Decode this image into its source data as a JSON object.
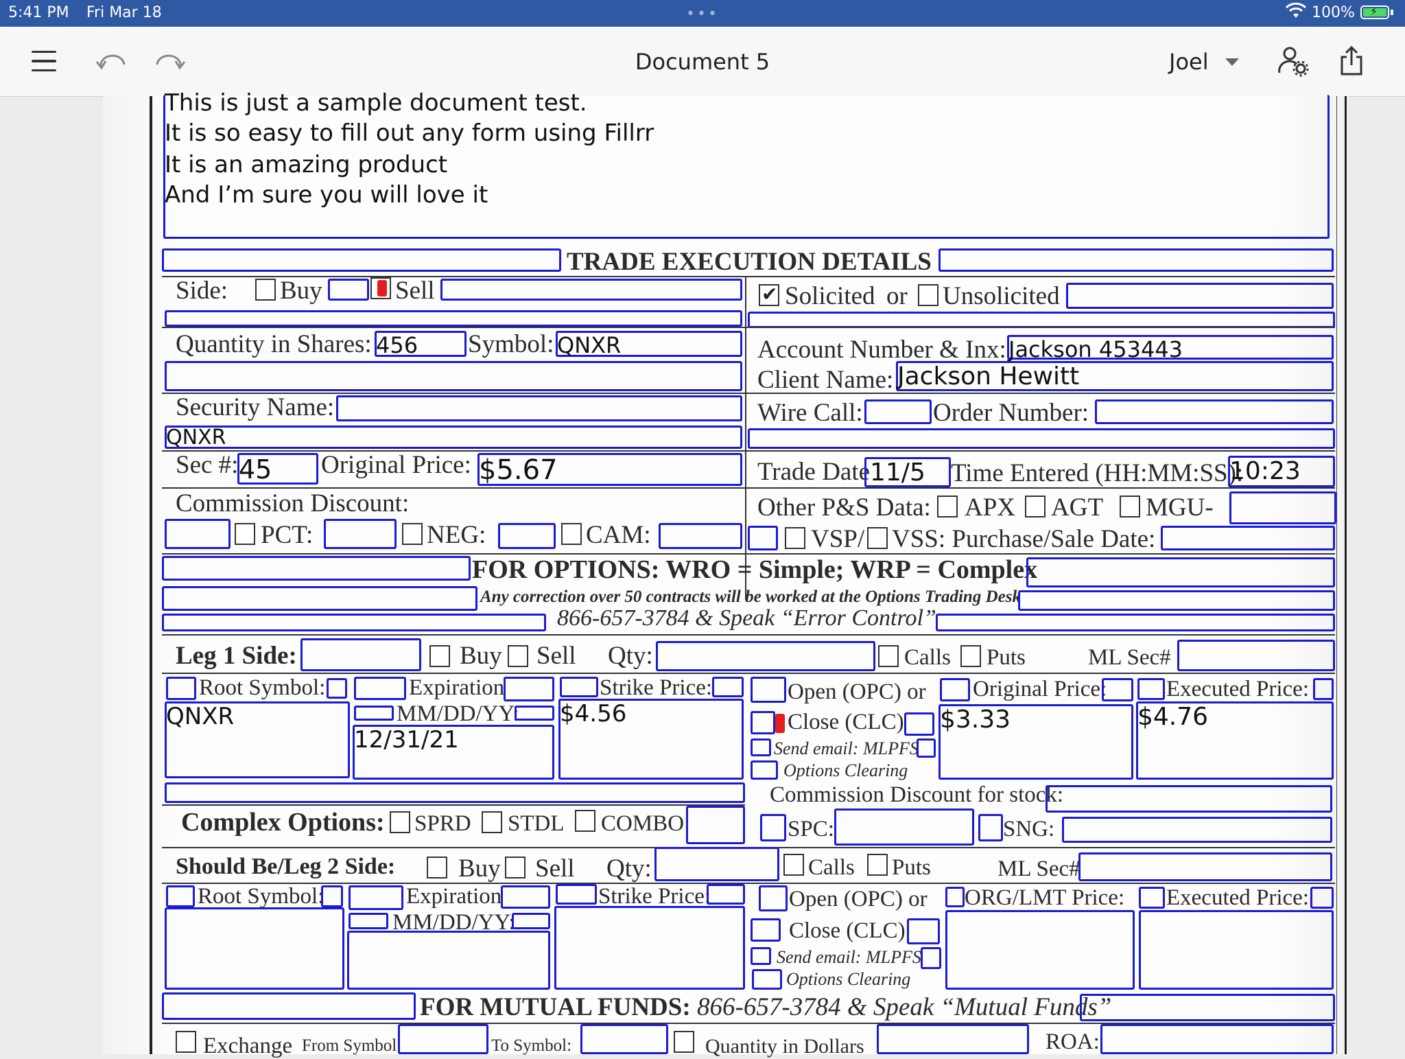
{
  "status_bar": {
    "time": "5:41 PM",
    "date": "Fri Mar 18",
    "battery": "100%"
  },
  "toolbar": {
    "title": "Document 5",
    "user": "Joel"
  },
  "notes": [
    "This is just a sample document test.",
    "It is so easy to fill out any form using Fillrr",
    "It is an amazing product",
    "And I’m sure you will love it"
  ],
  "trade": {
    "heading": "TRADE EXECUTION DETAILS",
    "side_label": "Side:",
    "buy": "Buy",
    "sell": "Sell",
    "solicited": "Solicited",
    "or": "or",
    "unsolicited": "Unsolicited",
    "quantity_label": "Quantity in Shares:",
    "quantity_value": "456",
    "symbol_label": "Symbol:",
    "symbol_value": "QNXR",
    "account_label": "Account Number & Inx:",
    "account_value": "Jackson 453443",
    "client_label": "Client Name:",
    "client_value": "Jackson Hewitt",
    "security_label": "Security Name:",
    "security_value": "QNXR",
    "wire_label": "Wire Call:",
    "order_label": "Order Number:",
    "sec_label": "Sec #:",
    "sec_value": "45",
    "orig_price_label": "Original Price:",
    "orig_price_value": "$5.67",
    "trade_date_label": "Trade Date",
    "trade_date_value": "11/5",
    "time_entered_label": "Time Entered (HH:MM:SS):",
    "time_entered_value": "10:23",
    "commission_label": "Commission Discount:",
    "other_ps_label": "Other P&S Data:",
    "apx": "APX",
    "agt": "AGT",
    "mgu": "MGU-",
    "pct": "PCT:",
    "neg": "NEG:",
    "cam": "CAM:",
    "vsp": "VSP/",
    "vss": "VSS: Purchase/Sale Date:"
  },
  "options": {
    "heading": "FOR OPTIONS: WRO = Simple; WRP = Complex",
    "correction": "Any correction over 50 contracts will be worked at the Options Trading Desk",
    "phone": "866-657-3784 & Speak “Error Control”",
    "leg1_label": "Leg 1  Side:",
    "buy": "Buy",
    "sell": "Sell",
    "qty": "Qty:",
    "calls": "Calls",
    "puts": "Puts",
    "ml_sec": "ML Sec#",
    "root_symbol": "Root Symbol:",
    "root_symbol_value": "QNXR",
    "expiration": "Expiration",
    "mmddyy": "MM/DD/YY:",
    "expiration_value": "12/31/21",
    "strike_price": "Strike Price:",
    "strike_value": "$4.56",
    "open_opc": "Open (OPC) or",
    "close_clc": "Close (CLC)",
    "send_email": "Send email: MLPFS",
    "options_clearing": "Options Clearing",
    "original_price": "Original Price:",
    "original_price_value": "$3.33",
    "executed_price": "Executed Price:",
    "executed_price_value": "$4.76",
    "commission_stock": "Commission Discount for stock:",
    "complex_label": "Complex Options:",
    "sprd": "SPRD",
    "stdl": "STDL",
    "combo": "COMBO",
    "spc": "SPC:",
    "sng": "SNG:",
    "leg2_label": "Should Be/Leg 2  Side:",
    "org_lmt": "ORG/LMT Price:"
  },
  "mutual": {
    "heading": "FOR MUTUAL FUNDS:",
    "phone": "866-657-3784 & Speak “Mutual Funds”",
    "exchange": "Exchange",
    "from_symbol": "From Symbol",
    "to_symbol": "To Symbol:",
    "qty_dollars": "Quantity in Dollars",
    "roa": "ROA:"
  },
  "colors": {
    "status_bar": "#2f59a3",
    "field_border": "#1b1bd6",
    "check_red": "#e21e1e"
  }
}
